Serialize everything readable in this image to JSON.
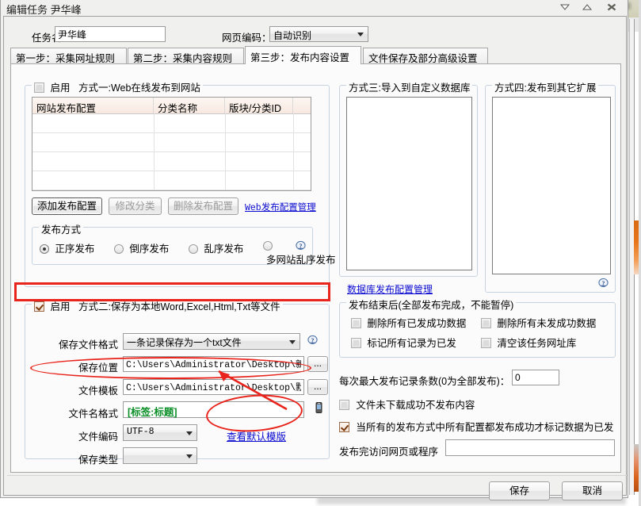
{
  "window": {
    "title": "编辑任务 尹华峰",
    "controls": [
      {
        "name": "minimize",
        "glyph": "chevron-down"
      },
      {
        "name": "maximize",
        "glyph": "chevron-up"
      },
      {
        "name": "close",
        "glyph": "x"
      }
    ]
  },
  "header": {
    "task_name_label": "任务名：",
    "task_name_value": "尹华峰",
    "encoding_label": "网页编码：",
    "encoding_value": "自动识别"
  },
  "tabs": [
    {
      "label": "第一步：采集网址规则",
      "active": false
    },
    {
      "label": "第二步：采集内容规则",
      "active": false
    },
    {
      "label": "第三步：发布内容设置",
      "active": true
    },
    {
      "label": "文件保存及部分高级设置",
      "active": false
    }
  ],
  "method_one": {
    "enable_label": "启用",
    "title": "方式一:Web在线发布到网站",
    "enabled": false,
    "table": {
      "columns": [
        "网站发布配置",
        "分类名称",
        "版块/分类ID"
      ],
      "rows": []
    },
    "buttons": [
      {
        "label": "添加发布配置",
        "disabled": false,
        "focus": true
      },
      {
        "label": "修改分类",
        "disabled": true,
        "focus": false
      },
      {
        "label": "删除发布配置",
        "disabled": true,
        "focus": false
      }
    ],
    "manage_link": "Web发布配置管理",
    "publish_mode": {
      "title": "发布方式",
      "options": [
        {
          "label": "正序发布",
          "selected": true
        },
        {
          "label": "倒序发布",
          "selected": false
        },
        {
          "label": "乱序发布",
          "selected": false
        },
        {
          "label": "多网站乱序发布",
          "selected": false
        }
      ]
    }
  },
  "method_two": {
    "enable_label": "启用",
    "title": "方式二:保存为本地Word,Excel,Html,Txt等文件",
    "enabled": true,
    "fields": {
      "file_format_label": "保存文件格式",
      "file_format_value": "一条记录保存为一个txt文件",
      "save_path_label": "保存位置",
      "save_path_value": "C:\\Users\\Administrator\\Desktop\\新建文f",
      "browse_label": "...",
      "template_label": "文件模板",
      "template_value": "C:\\Users\\Administrator\\Desktop\\默认tx",
      "filename_format_label": "文件名格式",
      "filename_format_value": "[标签:标题]",
      "encoding_label": "文件编码",
      "encoding_value": "UTF-8",
      "save_type_label": "保存类型",
      "save_type_value": ""
    },
    "view_template_link": "查看默认模版"
  },
  "method_three": {
    "title": "方式三:导入到自定义数据库",
    "manage_link": "数据库发布配置管理"
  },
  "method_four": {
    "title": "方式四:发布到其它扩展"
  },
  "after_publish": {
    "title": "发布结束后(全部发布完成，不能暂停)",
    "options": [
      {
        "label": "删除所有已发成功数据",
        "checked": false
      },
      {
        "label": "删除所有未发成功数据",
        "checked": false
      },
      {
        "label": "标记所有记录为已发",
        "checked": false
      },
      {
        "label": "清空该任务网址库",
        "checked": false
      }
    ]
  },
  "misc": {
    "max_records_label": "每次最大发布记录条数(0为全部发布)：",
    "max_records_value": "0",
    "not_downloaded_label": "文件未下载成功不发布内容",
    "not_downloaded_checked": false,
    "mark_all_label": "当所有的发布方式中所有配置都发布成功才标记数据为已发",
    "mark_all_checked": true,
    "after_url_label": "发布完访问网页或程序",
    "after_url_value": ""
  },
  "footer": {
    "save_label": "保存",
    "cancel_label": "取消"
  },
  "colors": {
    "annotation": "#e8241c",
    "link": "#0a0ad0",
    "green": "#0a8f27",
    "accent_orange": "#e8751a"
  }
}
